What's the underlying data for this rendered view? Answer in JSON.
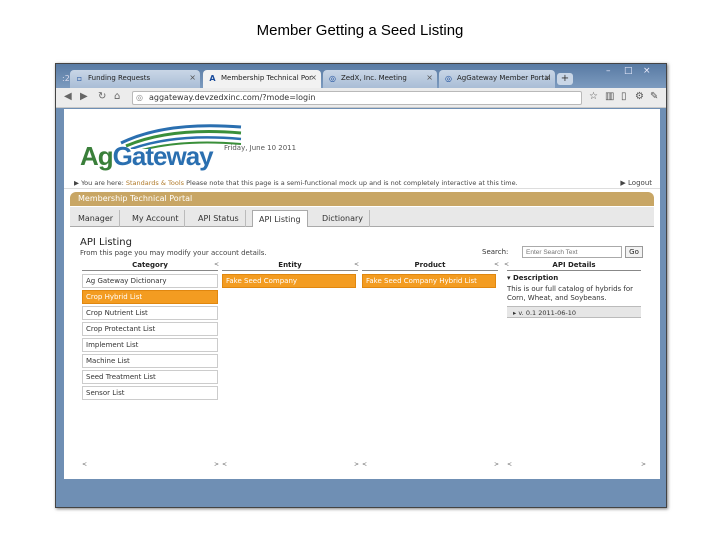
{
  "slide": {
    "title": "Member Getting a Seed Listing"
  },
  "browser": {
    "tabs": [
      {
        "label": "Funding Requests",
        "icon": "page-icon",
        "active": false
      },
      {
        "label": "Membership Technical Por",
        "icon": "a-icon",
        "active": true
      },
      {
        "label": "ZedX, Inc. Meeting",
        "icon": "globe-icon",
        "active": false
      },
      {
        "label": "AgGateway Member Portal",
        "icon": "globe-icon",
        "active": false
      }
    ],
    "url": "aggateway.devzedxinc.com/?mode=login",
    "window_controls": [
      "–",
      "□",
      "×"
    ]
  },
  "page": {
    "logo_prefix": "Ag",
    "logo_suffix": "Gateway",
    "date": "Friday, June 10 2011",
    "notice_prefix": "You are here:",
    "notice_link": "Standards & Tools",
    "notice_text": "Please note that this page is a semi-functional mock up and is not completely interactive at this time.",
    "logout": "Logout",
    "portal_title": "Membership Technical Portal",
    "nav_tabs": [
      "Manager",
      "My Account",
      "API Status",
      "API Listing",
      "Dictionary"
    ],
    "section_title": "API Listing",
    "section_sub": "From this page you may modify your account details.",
    "search_label": "Search:",
    "search_placeholder": "Enter Search Text",
    "go_label": "Go",
    "columns": [
      "Category",
      "Entity",
      "Product",
      "API Details"
    ],
    "categories": [
      "Ag Gateway Dictionary",
      "Crop Hybrid List",
      "Crop Nutrient List",
      "Crop Protectant List",
      "Implement List",
      "Machine List",
      "Seed Treatment List",
      "Sensor List"
    ],
    "entities": [
      "Fake Seed Company"
    ],
    "products": [
      "Fake Seed Company Hybrid List"
    ],
    "details": {
      "heading": "Description",
      "text": "This is our full catalog of hybrids for Corn, Wheat, and Soybeans.",
      "version": "v. 0.1  2011-06-10"
    }
  }
}
